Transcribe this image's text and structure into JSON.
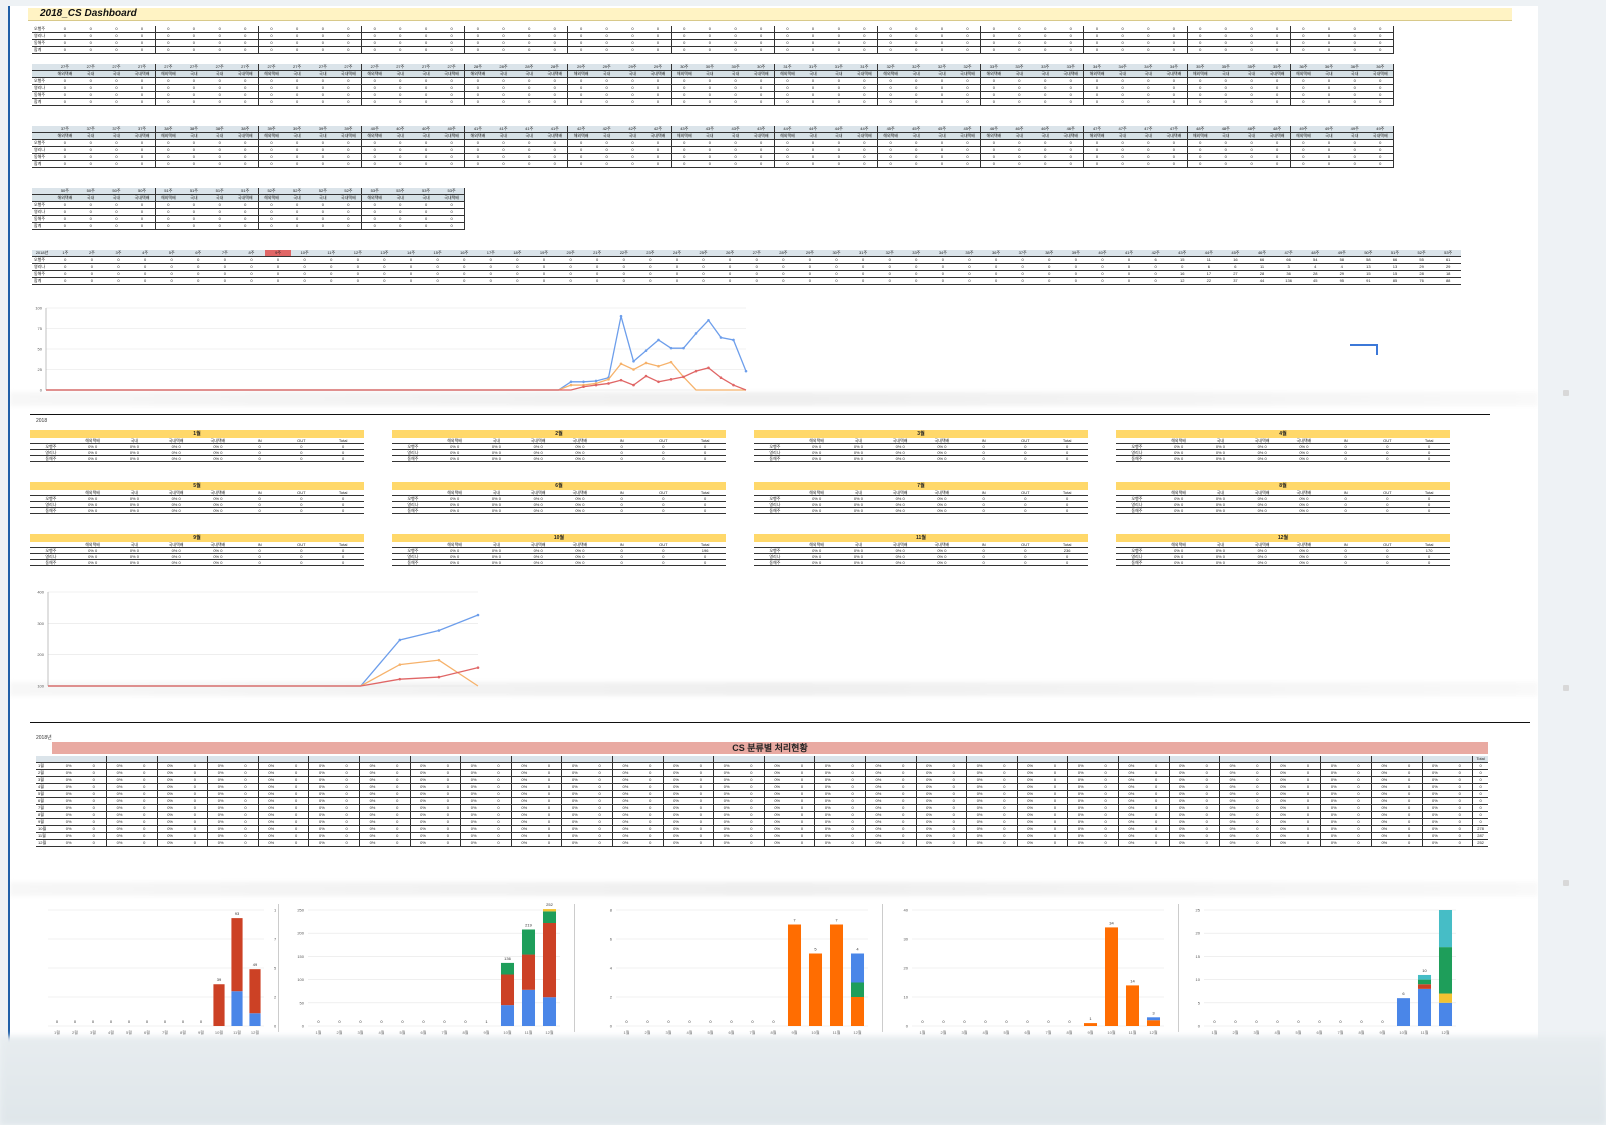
{
  "dashboard": {
    "title": "2018_CS Dashboard",
    "row_labels": [
      "오행주",
      "영리나",
      "동해주",
      "합계"
    ],
    "sub_headers": [
      "해외택배",
      "국내",
      "국내",
      "국내택배"
    ],
    "weeks_row1": [
      "27주",
      "27주",
      "27주",
      "27주",
      "27주",
      "27주",
      "27주",
      "27주",
      "27주",
      "27주",
      "27주",
      "27주",
      "27주",
      "27주",
      "27주",
      "27주",
      "28주",
      "28주",
      "28주",
      "28주",
      "29주",
      "29주",
      "29주",
      "29주",
      "30주",
      "30주",
      "30주",
      "30주",
      "31주",
      "31주",
      "31주",
      "31주",
      "32주",
      "32주",
      "32주",
      "32주",
      "33주",
      "33주",
      "33주",
      "33주",
      "34주",
      "34주",
      "34주",
      "34주",
      "35주",
      "35주",
      "35주",
      "35주",
      "36주",
      "36주",
      "36주",
      "36주"
    ],
    "weeks_row2": [
      "37주",
      "37주",
      "37주",
      "37주",
      "38주",
      "38주",
      "38주",
      "38주",
      "39주",
      "39주",
      "39주",
      "39주",
      "40주",
      "40주",
      "40주",
      "40주",
      "41주",
      "41주",
      "41주",
      "41주",
      "42주",
      "42주",
      "42주",
      "42주",
      "43주",
      "43주",
      "43주",
      "43주",
      "44주",
      "44주",
      "44주",
      "44주",
      "45주",
      "45주",
      "45주",
      "45주",
      "46주",
      "46주",
      "46주",
      "46주",
      "47주",
      "47주",
      "47주",
      "47주",
      "48주",
      "48주",
      "48주",
      "48주",
      "49주",
      "49주",
      "49주",
      "49주"
    ],
    "weeks_row3": [
      "50주",
      "50주",
      "50주",
      "50주",
      "51주",
      "51주",
      "51주",
      "51주",
      "52주",
      "52주",
      "52주",
      "52주",
      "53주",
      "53주",
      "53주",
      "53주"
    ],
    "year_label": "2018년",
    "annual_weeks": [
      "1주",
      "2주",
      "3주",
      "4주",
      "5주",
      "6주",
      "7주",
      "8주",
      "9주",
      "10주",
      "11주",
      "12주",
      "13주",
      "14주",
      "15주",
      "16주",
      "17주",
      "18주",
      "19주",
      "20주",
      "21주",
      "22주",
      "23주",
      "24주",
      "25주",
      "26주",
      "27주",
      "28주",
      "29주",
      "30주",
      "31주",
      "32주",
      "33주",
      "34주",
      "35주",
      "36주",
      "37주",
      "38주",
      "39주",
      "40주",
      "41주",
      "42주",
      "43주",
      "44주",
      "45주",
      "46주",
      "47주",
      "48주",
      "49주",
      "50주",
      "51주",
      "52주",
      "53주"
    ],
    "annual_values": [
      [
        "0",
        "0",
        "0",
        "0",
        "0",
        "0",
        "0",
        "0",
        "0",
        "0",
        "0",
        "0",
        "0",
        "0",
        "0",
        "0",
        "0",
        "0",
        "0",
        "0",
        "0",
        "0",
        "0",
        "0",
        "0",
        "0",
        "0",
        "0",
        "0",
        "0",
        "0",
        "0",
        "0",
        "0",
        "0",
        "0",
        "0",
        "0",
        "0",
        "0",
        "0",
        "6",
        "15",
        "11",
        "16",
        "66",
        "66",
        "54",
        "58",
        "58",
        "66",
        "55",
        "61",
        "31"
      ],
      [
        "0",
        "0",
        "0",
        "0",
        "0",
        "0",
        "0",
        "0",
        "0",
        "0",
        "0",
        "0",
        "0",
        "0",
        "0",
        "0",
        "0",
        "0",
        "0",
        "0",
        "0",
        "0",
        "0",
        "0",
        "0",
        "0",
        "0",
        "0",
        "0",
        "0",
        "0",
        "0",
        "0",
        "0",
        "0",
        "0",
        "0",
        "0",
        "0",
        "0",
        "0",
        "0",
        "0",
        "6",
        "6",
        "11",
        "3",
        "4",
        "4",
        "13",
        "13",
        "29",
        "29",
        "13",
        "2"
      ],
      [
        "0",
        "0",
        "0",
        "0",
        "0",
        "0",
        "0",
        "0",
        "0",
        "0",
        "0",
        "0",
        "0",
        "0",
        "0",
        "0",
        "0",
        "0",
        "0",
        "0",
        "0",
        "0",
        "0",
        "0",
        "0",
        "0",
        "0",
        "0",
        "0",
        "0",
        "0",
        "0",
        "0",
        "0",
        "0",
        "0",
        "0",
        "0",
        "0",
        "0",
        "0",
        "0",
        "16",
        "17",
        "27",
        "28",
        "36",
        "28",
        "29",
        "15",
        "15",
        "28",
        "18",
        "2"
      ],
      [
        "0",
        "0",
        "0",
        "0",
        "0",
        "0",
        "0",
        "0",
        "0",
        "0",
        "0",
        "0",
        "0",
        "0",
        "0",
        "0",
        "0",
        "0",
        "0",
        "0",
        "0",
        "0",
        "0",
        "0",
        "0",
        "0",
        "0",
        "0",
        "0",
        "0",
        "0",
        "0",
        "0",
        "0",
        "0",
        "0",
        "0",
        "0",
        "0",
        "0",
        "0",
        "0",
        "12",
        "22",
        "37",
        "44",
        "136",
        "45",
        "95",
        "91",
        "85",
        "76",
        "88",
        "111",
        "88",
        "71",
        "23"
      ]
    ]
  },
  "chart1": {
    "type": "line",
    "yticks": [
      "100",
      "75",
      "50",
      "25",
      "0"
    ],
    "ylim": [
      0,
      100
    ],
    "series": [
      {
        "color": "#6d9eeb",
        "values": [
          0,
          0,
          0,
          0,
          0,
          0,
          0,
          0,
          0,
          0,
          0,
          0,
          0,
          0,
          0,
          0,
          0,
          0,
          0,
          0,
          0,
          0,
          0,
          0,
          0,
          0,
          0,
          0,
          0,
          0,
          0,
          0,
          0,
          0,
          0,
          0,
          0,
          0,
          0,
          0,
          0,
          0,
          10,
          10,
          11,
          15,
          90,
          35,
          48,
          61,
          51,
          51,
          69,
          85,
          64,
          61,
          23
        ]
      },
      {
        "color": "#f6b26b",
        "values": [
          0,
          0,
          0,
          0,
          0,
          0,
          0,
          0,
          0,
          0,
          0,
          0,
          0,
          0,
          0,
          0,
          0,
          0,
          0,
          0,
          0,
          0,
          0,
          0,
          0,
          0,
          0,
          0,
          0,
          0,
          0,
          0,
          0,
          0,
          0,
          0,
          0,
          0,
          0,
          0,
          0,
          0,
          6,
          6,
          8,
          13,
          32,
          25,
          33,
          29,
          34,
          16,
          0,
          0,
          0,
          0,
          0
        ]
      },
      {
        "color": "#e06666",
        "values": [
          0,
          0,
          0,
          0,
          0,
          0,
          0,
          0,
          0,
          0,
          0,
          0,
          0,
          0,
          0,
          0,
          0,
          0,
          0,
          0,
          0,
          0,
          0,
          0,
          0,
          0,
          0,
          0,
          0,
          0,
          0,
          0,
          0,
          0,
          0,
          0,
          0,
          0,
          0,
          0,
          0,
          0,
          0,
          4,
          6,
          8,
          12,
          6,
          17,
          10,
          13,
          16,
          23,
          27,
          15,
          6,
          0
        ]
      }
    ]
  },
  "monthly": {
    "year_label": "2018",
    "col_headers": [
      "해외택배",
      "국내",
      "국내택배",
      "국내택배",
      "IN",
      "OUT",
      "Total"
    ],
    "row_labels": [
      "오행주",
      "영리나",
      "동해주"
    ],
    "months": [
      "1월",
      "2월",
      "3월",
      "4월",
      "5월",
      "6월",
      "7월",
      "8월",
      "9월",
      "10월",
      "11월",
      "12월"
    ],
    "totals": [
      "0",
      "0",
      "0",
      "0",
      "0",
      "0",
      "0",
      "0",
      "0",
      "196",
      "236",
      "170"
    ]
  },
  "chart2": {
    "type": "line",
    "yticks": [
      "400",
      "300",
      "200",
      "100"
    ],
    "ylim": [
      0,
      400
    ],
    "series": [
      {
        "color": "#6d9eeb",
        "values": [
          0,
          0,
          0,
          0,
          0,
          0,
          0,
          0,
          0,
          196,
          236,
          302
        ]
      },
      {
        "color": "#f6b26b",
        "values": [
          0,
          0,
          0,
          0,
          0,
          0,
          0,
          0,
          0,
          91,
          110,
          0
        ]
      },
      {
        "color": "#e06666",
        "values": [
          0,
          0,
          0,
          0,
          0,
          0,
          0,
          0,
          0,
          29,
          38,
          78
        ]
      }
    ]
  },
  "cs_table": {
    "year_label": "2018년",
    "title": "CS 분류별 처리현황",
    "months": [
      "1월",
      "2월",
      "3월",
      "4월",
      "5월",
      "6월",
      "7월",
      "8월",
      "9월",
      "10월",
      "11월",
      "12월"
    ],
    "totals": [
      "0",
      "0",
      "0",
      "0",
      "0",
      "0",
      "0",
      "0",
      "0",
      "278",
      "287",
      "252"
    ],
    "total_label": "Total"
  },
  "bar_charts": [
    {
      "type": "bar",
      "categories": [
        "1월",
        "2월",
        "3월",
        "4월",
        "5월",
        "6월",
        "7월",
        "8월",
        "9월",
        "10월",
        "11월",
        "12월"
      ],
      "ylim": [
        0,
        100
      ],
      "yticks": [
        "100",
        "75",
        "50",
        "25",
        "0"
      ],
      "series": [
        {
          "color": "#4a86e8",
          "values": [
            0,
            0,
            0,
            0,
            0,
            0,
            0,
            0,
            0,
            0,
            30,
            11
          ]
        },
        {
          "color": "#cc4125",
          "values": [
            0,
            0,
            0,
            0,
            0,
            0,
            0,
            0,
            0,
            36,
            63,
            38
          ]
        }
      ],
      "labels": [
        "0",
        "0",
        "0",
        "0",
        "0",
        "0",
        "0",
        "0",
        "0",
        "39",
        "93",
        "49"
      ]
    },
    {
      "type": "bar",
      "categories": [
        "1월",
        "2월",
        "3월",
        "4월",
        "5월",
        "6월",
        "7월",
        "8월",
        "9월",
        "10월",
        "11월",
        "12월"
      ],
      "ylim": [
        0,
        250
      ],
      "yticks": [
        "250",
        "200",
        "150",
        "100",
        "50",
        "0"
      ],
      "series": [
        {
          "color": "#4a86e8",
          "values": [
            0,
            0,
            0,
            0,
            0,
            0,
            0,
            0,
            0,
            45,
            78,
            62
          ]
        },
        {
          "color": "#cc4125",
          "values": [
            0,
            0,
            0,
            0,
            0,
            0,
            0,
            0,
            0,
            66,
            76,
            160
          ]
        },
        {
          "color": "#1e9e5a",
          "values": [
            0,
            0,
            0,
            0,
            0,
            0,
            0,
            0,
            0,
            25,
            54,
            25
          ]
        },
        {
          "color": "#f1c232",
          "values": [
            0,
            0,
            0,
            0,
            0,
            0,
            0,
            0,
            0,
            0,
            0,
            5
          ]
        }
      ],
      "labels": [
        "0",
        "0",
        "0",
        "0",
        "0",
        "0",
        "0",
        "0",
        "1",
        "136",
        "219",
        "252"
      ]
    },
    {
      "type": "bar",
      "categories": [
        "1월",
        "2월",
        "3월",
        "4월",
        "5월",
        "6월",
        "7월",
        "8월",
        "9월",
        "10월",
        "11월",
        "12월"
      ],
      "ylim": [
        0,
        8
      ],
      "yticks": [
        "8",
        "6",
        "4",
        "2",
        "0"
      ],
      "series": [
        {
          "color": "#ff6d01",
          "values": [
            0,
            0,
            0,
            0,
            0,
            0,
            0,
            0,
            7,
            5,
            7,
            2
          ]
        },
        {
          "color": "#1e9e5a",
          "values": [
            0,
            0,
            0,
            0,
            0,
            0,
            0,
            0,
            0,
            0,
            0,
            1
          ]
        },
        {
          "color": "#4a86e8",
          "values": [
            0,
            0,
            0,
            0,
            0,
            0,
            0,
            0,
            0,
            0,
            0,
            2
          ]
        }
      ],
      "labels": [
        "0",
        "0",
        "0",
        "0",
        "0",
        "0",
        "0",
        "0",
        "7",
        "5",
        "7",
        "4"
      ]
    },
    {
      "type": "bar",
      "categories": [
        "1월",
        "2월",
        "3월",
        "4월",
        "5월",
        "6월",
        "7월",
        "8월",
        "9월",
        "10월",
        "11월",
        "12월"
      ],
      "ylim": [
        0,
        40
      ],
      "yticks": [
        "40",
        "30",
        "20",
        "10",
        "0"
      ],
      "series": [
        {
          "color": "#ff6d01",
          "values": [
            0,
            0,
            0,
            0,
            0,
            0,
            0,
            0,
            1,
            34,
            14,
            2
          ]
        },
        {
          "color": "#4a86e8",
          "values": [
            0,
            0,
            0,
            0,
            0,
            0,
            0,
            0,
            0,
            0,
            0,
            1
          ]
        }
      ],
      "labels": [
        "0",
        "0",
        "0",
        "0",
        "0",
        "0",
        "0",
        "0",
        "1",
        "34",
        "14",
        "3"
      ]
    },
    {
      "type": "bar",
      "categories": [
        "1월",
        "2월",
        "3월",
        "4월",
        "5월",
        "6월",
        "7월",
        "8월",
        "9월",
        "10월",
        "11월",
        "12월"
      ],
      "ylim": [
        0,
        25
      ],
      "yticks": [
        "25",
        "20",
        "15",
        "10",
        "5",
        "0"
      ],
      "series": [
        {
          "color": "#4a86e8",
          "values": [
            0,
            0,
            0,
            0,
            0,
            0,
            0,
            0,
            0,
            6,
            8,
            5
          ]
        },
        {
          "color": "#cc4125",
          "values": [
            0,
            0,
            0,
            0,
            0,
            0,
            0,
            0,
            0,
            0,
            1,
            0
          ]
        },
        {
          "color": "#f1c232",
          "values": [
            0,
            0,
            0,
            0,
            0,
            0,
            0,
            0,
            0,
            0,
            0,
            2
          ]
        },
        {
          "color": "#1e9e5a",
          "values": [
            0,
            0,
            0,
            0,
            0,
            0,
            0,
            0,
            0,
            0,
            1,
            10
          ]
        },
        {
          "color": "#46bdc6",
          "values": [
            0,
            0,
            0,
            0,
            0,
            0,
            0,
            0,
            0,
            0,
            1,
            8
          ]
        }
      ],
      "labels": [
        "0",
        "0",
        "0",
        "0",
        "0",
        "0",
        "0",
        "0",
        "0",
        "6",
        "10",
        ""
      ]
    }
  ]
}
